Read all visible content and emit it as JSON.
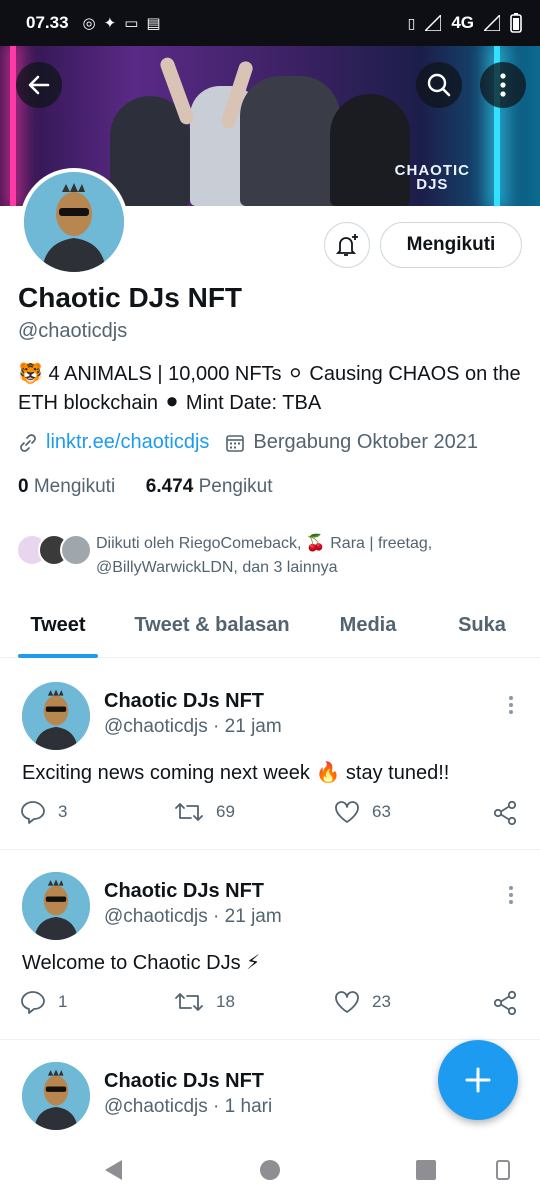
{
  "status_bar": {
    "time": "07.33",
    "network": "4G"
  },
  "banner": {
    "wordmark_line1": "CHAOTIC",
    "wordmark_line2": "DJS"
  },
  "profile": {
    "name": "Chaotic DJs NFT",
    "handle": "@chaoticdjs",
    "follow_button_label": "Mengikuti",
    "bio": "🐯 4 ANIMALS | 10,000 NFTs ⚪ Causing CHAOS on the ETH blockchain ⚫ Mint Date: TBA",
    "link": "linktr.ee/chaoticdjs",
    "joined": "Bergabung Oktober 2021",
    "following_count": "0",
    "following_label": "Mengikuti",
    "followers_count": "6.474",
    "followers_label": "Pengikut",
    "followed_by": "Diikuti oleh RiegoComeback, 🍒 Rara | freetag, @BillyWarwickLDN, dan 3 lainnya"
  },
  "tabs": [
    {
      "label": "Tweet",
      "active": true
    },
    {
      "label": "Tweet & balasan",
      "active": false
    },
    {
      "label": "Media",
      "active": false
    },
    {
      "label": "Suka",
      "active": false
    }
  ],
  "tweets": [
    {
      "name": "Chaotic DJs NFT",
      "handle": "@chaoticdjs · 21 jam",
      "text": "Exciting news coming next week 🔥 stay tuned!!",
      "replies": "3",
      "retweets": "69",
      "likes": "63"
    },
    {
      "name": "Chaotic DJs NFT",
      "handle": "@chaoticdjs · 21 jam",
      "text": "Welcome to Chaotic DJs ⚡",
      "replies": "1",
      "retweets": "18",
      "likes": "23"
    },
    {
      "name": "Chaotic DJs NFT",
      "handle": "@chaoticdjs · 1 hari",
      "text": ""
    }
  ],
  "icons": [
    "back-arrow-icon",
    "search-icon",
    "more-vertical-icon",
    "bell-plus-icon",
    "link-icon",
    "calendar-icon",
    "reply-icon",
    "retweet-icon",
    "like-icon",
    "share-icon",
    "compose-plus-icon"
  ],
  "colors": {
    "accent": "#1d9bf0",
    "text": "#0f1419",
    "muted": "#536471"
  }
}
